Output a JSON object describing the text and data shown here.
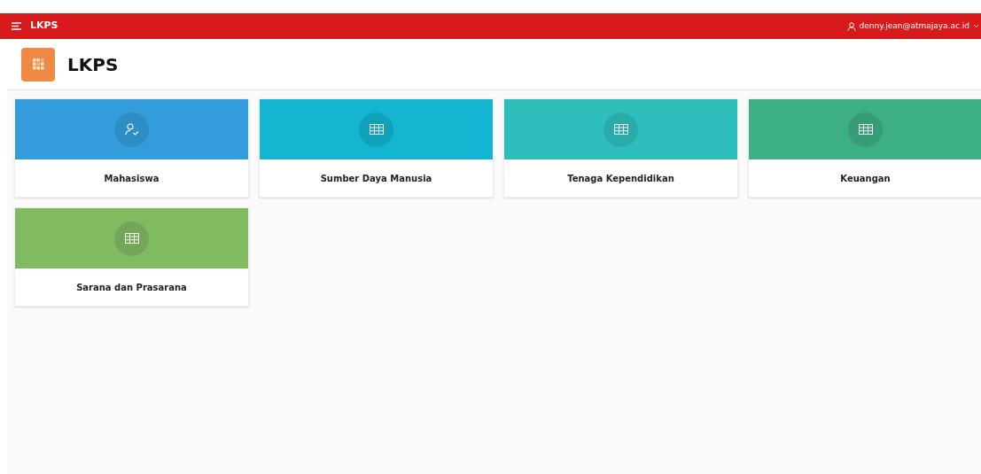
{
  "top_bar": {
    "app_name": "LKPS",
    "user": "denny.jean@atmajaya.ac.id"
  },
  "page_header": {
    "title": "LKPS"
  },
  "cards": [
    {
      "label": "Mahasiswa",
      "kind": "user",
      "color": "#339ddb"
    },
    {
      "label": "Sumber Daya Manusia",
      "kind": "table",
      "color": "#13b5d0"
    },
    {
      "label": "Tenaga Kependidikan",
      "kind": "table",
      "color": "#2ebfbd"
    },
    {
      "label": "Keuangan",
      "kind": "table",
      "color": "#3daf84"
    },
    {
      "label": "Sarana dan Prasarana",
      "kind": "table",
      "color": "#80ba61"
    }
  ]
}
